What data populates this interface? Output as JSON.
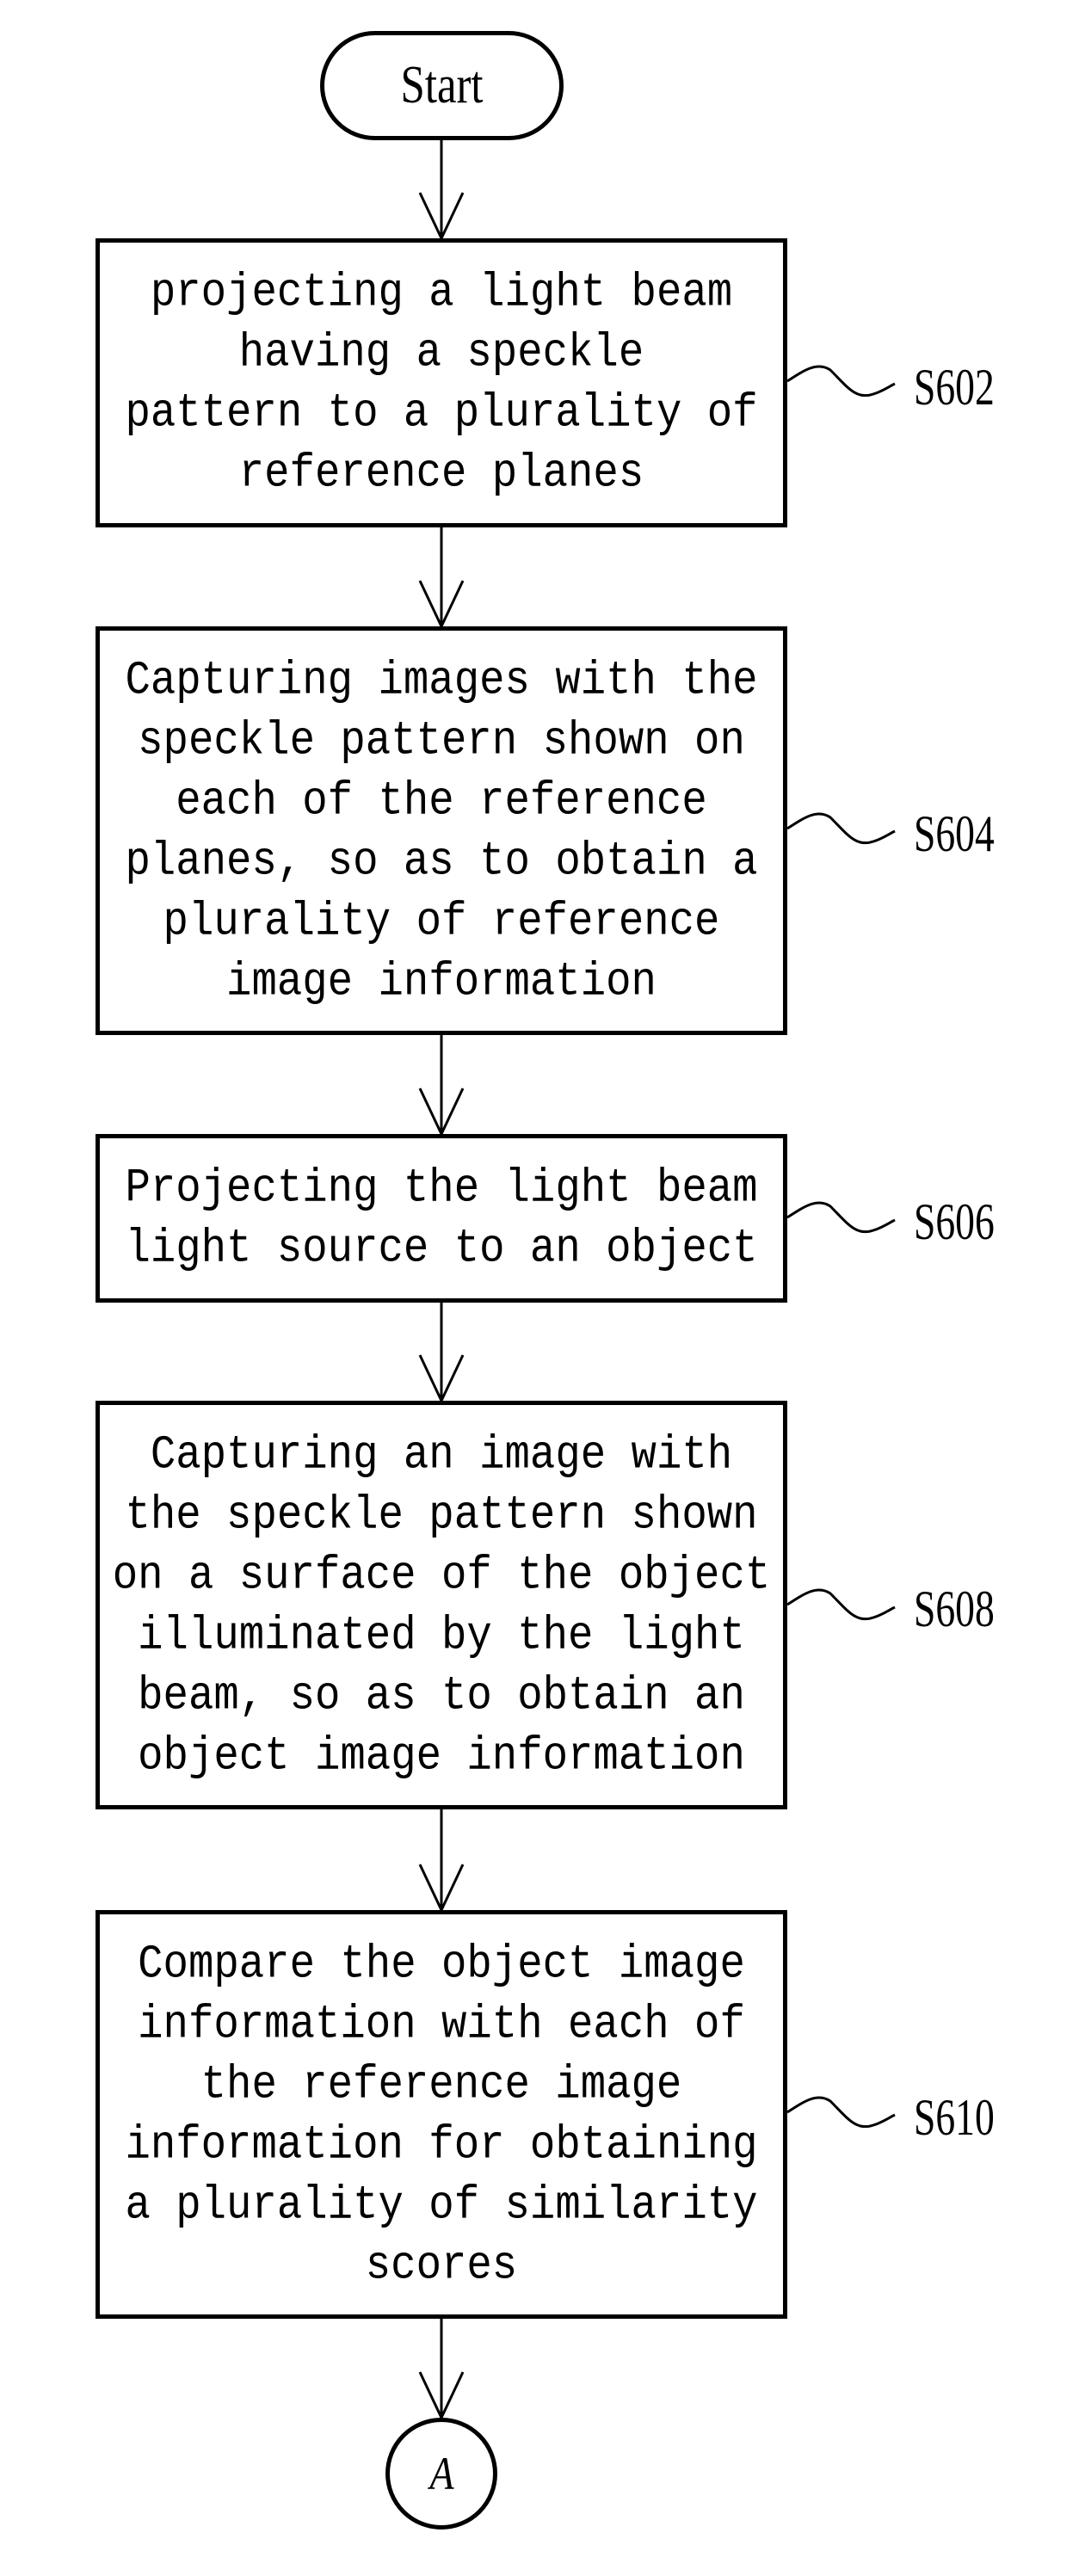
{
  "flowchart": {
    "start_label": "Start",
    "end_connector_label": "A",
    "steps": [
      {
        "id": "S602",
        "lines": [
          "projecting a light beam",
          "having a speckle",
          "pattern to a plurality of",
          "reference planes"
        ]
      },
      {
        "id": "S604",
        "lines": [
          "Capturing images with the",
          "speckle pattern shown on",
          "each of the reference",
          "planes, so as to obtain a",
          "plurality of reference",
          "image information"
        ]
      },
      {
        "id": "S606",
        "lines": [
          "Projecting the light beam",
          "light source to an object"
        ]
      },
      {
        "id": "S608",
        "lines": [
          "Capturing an image with",
          "the speckle pattern shown",
          "on a surface of the object",
          "illuminated by the light",
          "beam, so as to obtain an",
          "object image information"
        ]
      },
      {
        "id": "S610",
        "lines": [
          "Compare the object image",
          "information with each of",
          "the reference image",
          "information for obtaining",
          "a plurality of similarity",
          "scores"
        ]
      }
    ]
  }
}
